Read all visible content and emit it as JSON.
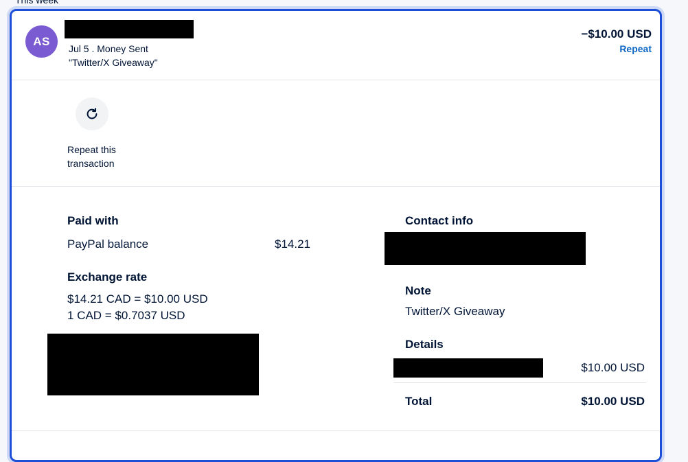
{
  "section_label": "This week",
  "transaction": {
    "avatar_initials": "AS",
    "date_type": "Jul 5 . Money Sent",
    "note_quoted": "\"Twitter/X Giveaway\"",
    "amount": "−$10.00 USD",
    "repeat_label": "Repeat"
  },
  "repeat_action": {
    "label": "Repeat this transaction",
    "icon": "refresh-icon"
  },
  "paid_with": {
    "heading": "Paid with",
    "method": "PayPal balance",
    "amount": "$14.21"
  },
  "exchange_rate": {
    "heading": "Exchange rate",
    "line1": "$14.21 CAD = $10.00 USD",
    "line2": "1 CAD = $0.7037 USD"
  },
  "contact_info": {
    "heading": "Contact info"
  },
  "note": {
    "heading": "Note",
    "text": "Twitter/X Giveaway"
  },
  "details": {
    "heading": "Details",
    "item_amount": "$10.00 USD",
    "total_label": "Total",
    "total_amount": "$10.00 USD"
  },
  "colors": {
    "accent_blue": "#1d4ed8",
    "link_blue": "#0a66c2",
    "avatar_purple": "#7b5bd1",
    "text_dark": "#001435"
  }
}
